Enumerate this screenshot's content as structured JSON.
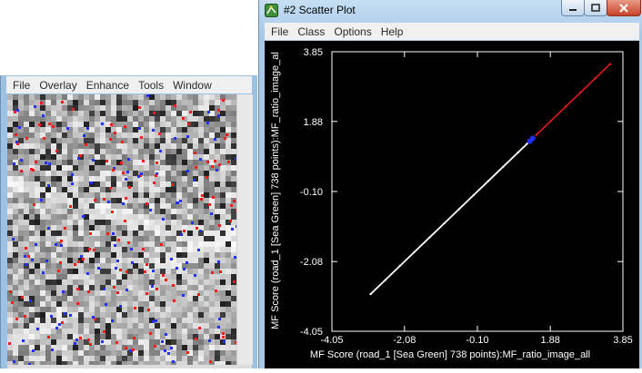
{
  "image_window": {
    "menu": [
      "File",
      "Overlay",
      "Enhance",
      "Tools",
      "Window"
    ]
  },
  "scatter_window": {
    "title": "#2 Scatter Plot",
    "menu": [
      "File",
      "Class",
      "Options",
      "Help"
    ],
    "icons": {
      "app": "scatter-plot-app-icon",
      "minimize": "minimize-icon",
      "maximize": "maximize-icon",
      "close": "close-icon"
    }
  },
  "colors": {
    "plot_bg": "#000000",
    "axes": "#ffffff",
    "main_series": "#ffffff",
    "class_red": "#ff1a1a",
    "class_blue": "#2230ff",
    "titlebar": "#c6dff3"
  },
  "chart_data": {
    "type": "scatter",
    "xlabel": "MF Score (road_1 [Sea Green] 738 points):MF_ratio_image_all",
    "ylabel": "MF Score (road_1 [Sea Green] 738 points):MF_ratio_image_al",
    "xlim": [
      -4.05,
      3.85
    ],
    "ylim": [
      -4.05,
      3.85
    ],
    "xticks": [
      "-4.05",
      "-2.08",
      "-0.10",
      "1.88",
      "3.85"
    ],
    "yticks": [
      "3.85",
      "1.88",
      "-0.10",
      "-2.08",
      "-4.05"
    ],
    "grid": false,
    "series": [
      {
        "color": "#ffffff",
        "x": [
          -3.0,
          -2.6,
          -2.2,
          -1.8,
          -1.4,
          -1.0,
          -0.6,
          -0.2,
          0.2,
          0.6,
          1.0,
          1.25
        ],
        "y": [
          -3.0,
          -2.6,
          -2.2,
          -1.8,
          -1.4,
          -1.0,
          -0.6,
          -0.2,
          0.2,
          0.6,
          1.0,
          1.25
        ]
      },
      {
        "color": "#ff1a1a",
        "x": [
          1.5,
          1.9,
          2.3,
          2.7,
          3.1,
          3.5
        ],
        "y": [
          1.5,
          1.9,
          2.3,
          2.7,
          3.1,
          3.5
        ]
      },
      {
        "color": "#2230ff",
        "x": [
          1.32,
          1.4
        ],
        "y": [
          1.32,
          1.4
        ]
      }
    ]
  }
}
